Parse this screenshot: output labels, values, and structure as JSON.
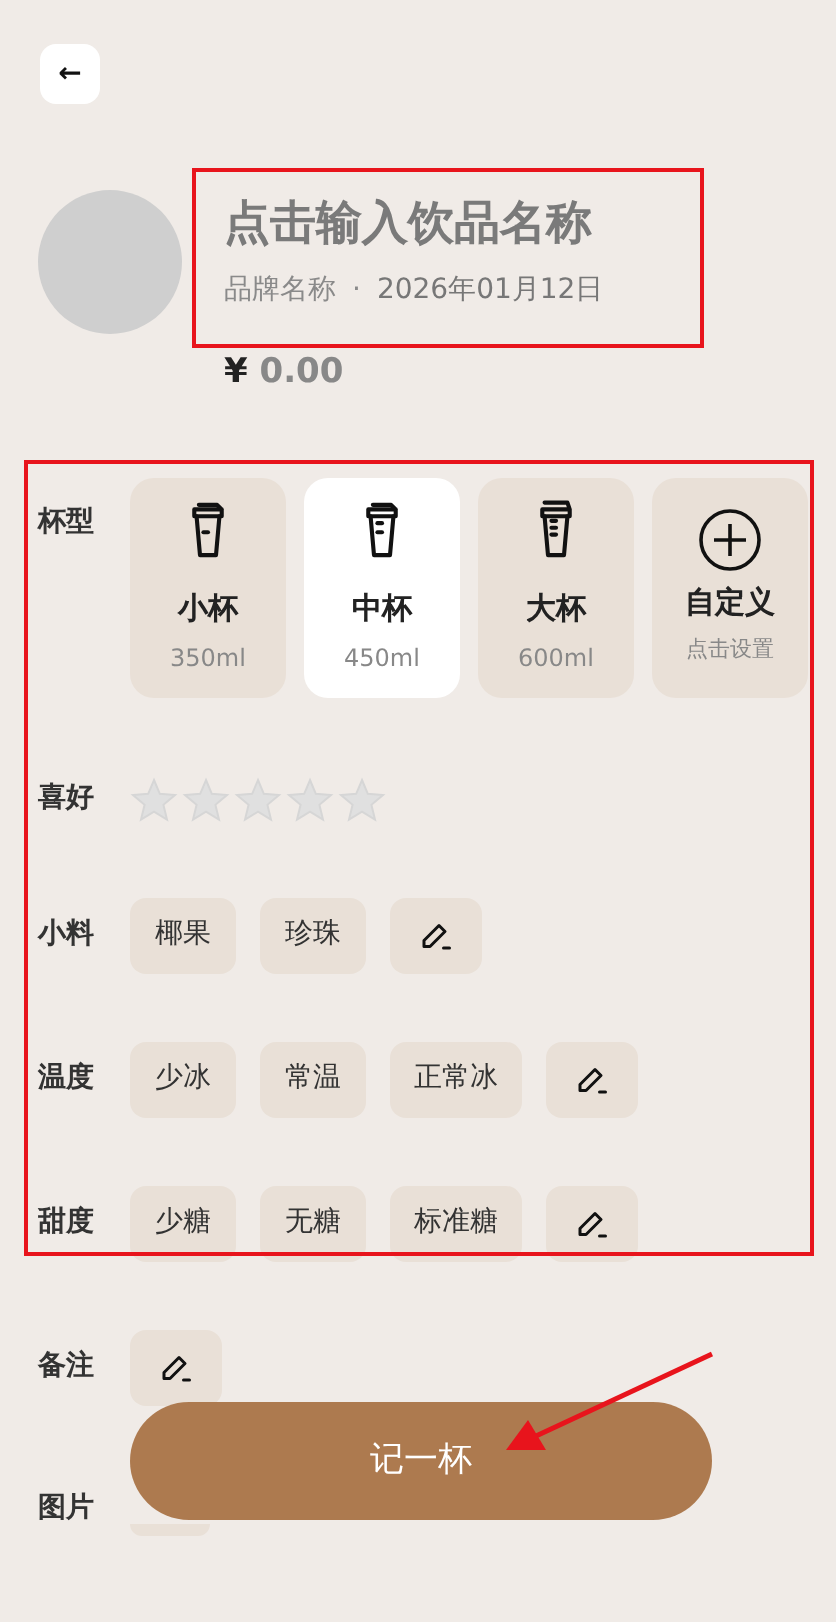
{
  "header": {
    "back": "←"
  },
  "drink": {
    "name_placeholder": "点击输入饮品名称",
    "brand": "品牌名称",
    "separator": "·",
    "date": "2026年01月12日",
    "currency": "¥",
    "price": "0.00"
  },
  "rows": [
    {
      "kind": "cups",
      "label": "杯型",
      "options": [
        {
          "kind": "small",
          "name": "小杯",
          "detail": "350ml",
          "selected": false
        },
        {
          "kind": "medium",
          "name": "中杯",
          "detail": "450ml",
          "selected": true
        },
        {
          "kind": "large",
          "name": "大杯",
          "detail": "600ml",
          "selected": false
        },
        {
          "kind": "custom",
          "name": "自定义",
          "detail": "点击设置",
          "selected": false
        }
      ]
    },
    {
      "kind": "stars",
      "label": "喜好",
      "stars": 0
    },
    {
      "kind": "chips",
      "label": "小料",
      "chips": [
        {
          "kind": "option",
          "label": "椰果",
          "selected": false
        },
        {
          "kind": "option",
          "label": "珍珠",
          "selected": false
        },
        {
          "kind": "edit"
        }
      ]
    },
    {
      "kind": "chips",
      "label": "温度",
      "chips": [
        {
          "kind": "option",
          "label": "少冰",
          "selected": false
        },
        {
          "kind": "option",
          "label": "常温",
          "selected": false
        },
        {
          "kind": "option",
          "label": "正常冰",
          "selected": false
        },
        {
          "kind": "edit"
        }
      ]
    },
    {
      "kind": "chips",
      "label": "甜度",
      "chips": [
        {
          "kind": "option",
          "label": "少糖",
          "selected": false
        },
        {
          "kind": "option",
          "label": "无糖",
          "selected": false
        },
        {
          "kind": "option",
          "label": "标准糖",
          "selected": false
        },
        {
          "kind": "edit"
        }
      ]
    },
    {
      "kind": "chips",
      "label": "备注",
      "chips": [
        {
          "kind": "edit"
        }
      ]
    },
    {
      "kind": "photo",
      "label": "图片"
    }
  ],
  "submit": "记一杯"
}
